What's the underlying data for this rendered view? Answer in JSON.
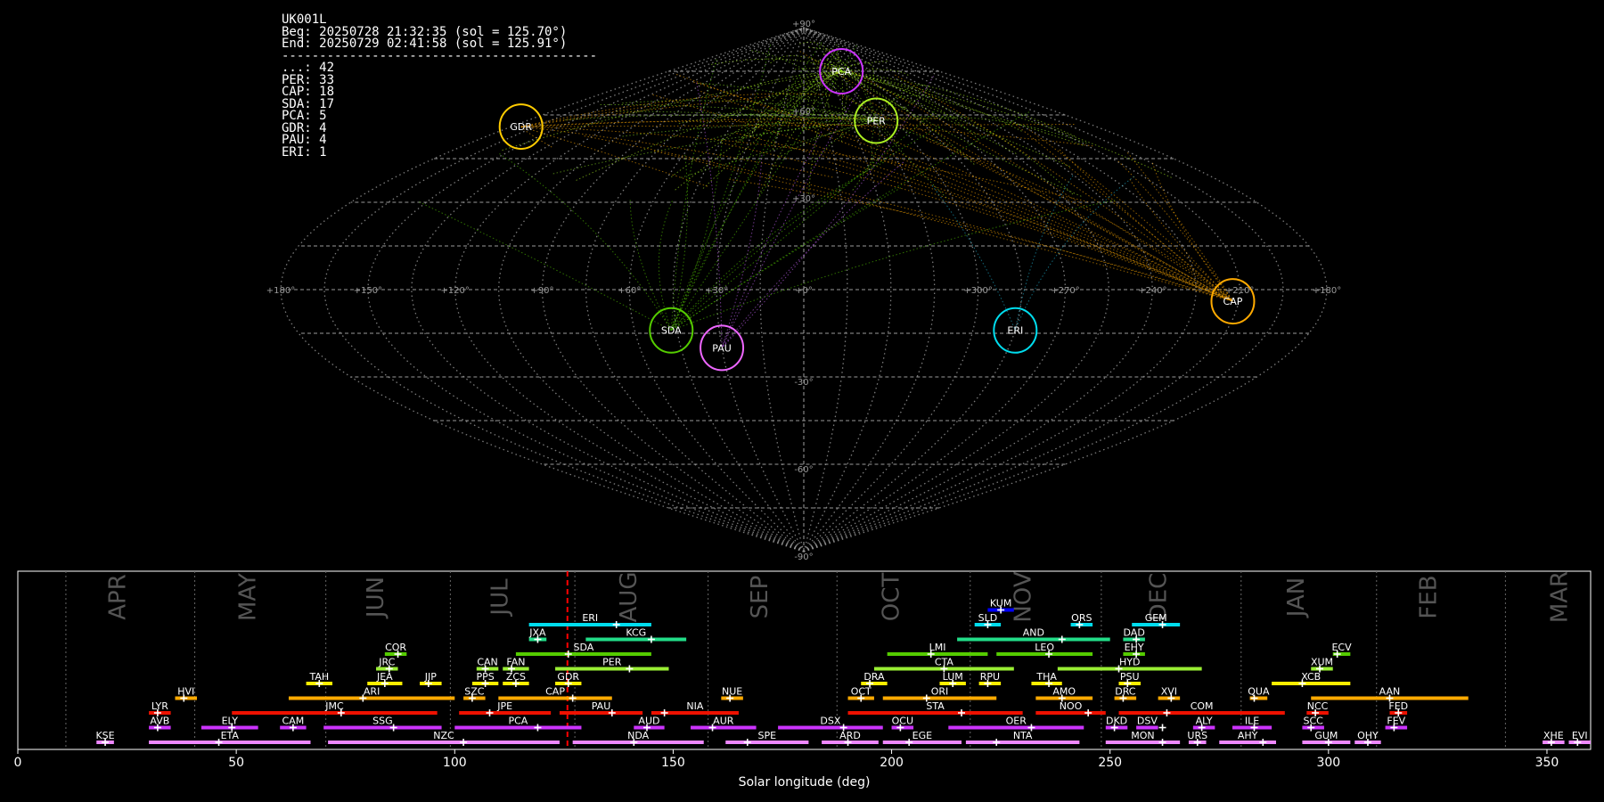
{
  "header": {
    "station": "UK001L",
    "begin": "Beg: 20250728 21:32:35 (sol = 125.70°)",
    "end": "End: 20250729 02:41:58 (sol = 125.91°)",
    "separator": "------------------------------------------",
    "counts": [
      {
        "code": "...",
        "count": 42
      },
      {
        "code": "PER",
        "count": 33
      },
      {
        "code": "CAP",
        "count": 18
      },
      {
        "code": "SDA",
        "count": 17
      },
      {
        "code": "PCA",
        "count": 5
      },
      {
        "code": "GDR",
        "count": 4
      },
      {
        "code": "PAU",
        "count": 4
      },
      {
        "code": "ERI",
        "count": 1
      }
    ]
  },
  "colors": {
    "background": "#000000",
    "grid": "#9a9a9a",
    "sporadic": "#aaee22",
    "current_marker": "#ff0000",
    "month_text": "#555555"
  },
  "chart_data": [
    {
      "type": "scatter",
      "projection": "sinusoidal",
      "title": "",
      "lon_ticks": [
        "+180°",
        "+150°",
        "+120°",
        "+90°",
        "+60°",
        "+30°",
        "+0°",
        "+300°",
        "+270°",
        "+240°",
        "+210°",
        "+180°"
      ],
      "lat_ticks": [
        "+90°",
        "+60°",
        "+30°",
        "-30°",
        "-60°",
        "-90°"
      ],
      "radiants": [
        {
          "name": "PCA",
          "lon": -50,
          "lat": 75,
          "color": "#cc33ff"
        },
        {
          "name": "PER",
          "lon": -47,
          "lat": 58,
          "color": "#aaee22"
        },
        {
          "name": "GDR",
          "lon": 174,
          "lat": 56,
          "color": "#ffcc00"
        },
        {
          "name": "CAP",
          "lon": 212,
          "lat": -4,
          "color": "#ffaa00"
        },
        {
          "name": "SDA",
          "lon": 47,
          "lat": -14,
          "color": "#55cc00"
        },
        {
          "name": "PAU",
          "lon": 30,
          "lat": -20,
          "color": "#ee66ff"
        },
        {
          "name": "ERI",
          "lon": -75,
          "lat": -14,
          "color": "#00ddee"
        }
      ]
    },
    {
      "type": "bar",
      "title": "",
      "xlabel": "Solar longitude (deg)",
      "ylabel": "",
      "xlim": [
        0,
        360
      ],
      "x_ticks": [
        0,
        50,
        100,
        150,
        200,
        250,
        300,
        350
      ],
      "current_sol": 125.8,
      "months": [
        {
          "name": "APR",
          "start": 11
        },
        {
          "name": "MAY",
          "start": 40.5
        },
        {
          "name": "JUN",
          "start": 70.5
        },
        {
          "name": "JUL",
          "start": 99
        },
        {
          "name": "AUG",
          "start": 127.5
        },
        {
          "name": "SEP",
          "start": 158
        },
        {
          "name": "OCT",
          "start": 187.5
        },
        {
          "name": "NOV",
          "start": 218
        },
        {
          "name": "DEC",
          "start": 248
        },
        {
          "name": "JAN",
          "start": 280
        },
        {
          "name": "FEB",
          "start": 311
        },
        {
          "name": "MAR",
          "start": 340.5
        }
      ],
      "showers": [
        {
          "code": "KUM",
          "start": 222,
          "end": 228,
          "peak": 225,
          "row": 9,
          "color": "#0000ff"
        },
        {
          "code": "ERI",
          "start": 117,
          "end": 145,
          "peak": 137,
          "row": 8,
          "color": "#00ddee"
        },
        {
          "code": "SLD",
          "start": 219,
          "end": 225,
          "peak": 222,
          "row": 8,
          "color": "#00ddee"
        },
        {
          "code": "ORS",
          "start": 241,
          "end": 246,
          "peak": 243,
          "row": 8,
          "color": "#00ddee"
        },
        {
          "code": "GEM",
          "start": 255,
          "end": 266,
          "peak": 262,
          "row": 8,
          "color": "#00ddee"
        },
        {
          "code": "JXA",
          "start": 117,
          "end": 121,
          "peak": 119,
          "row": 7,
          "color": "#22dd88"
        },
        {
          "code": "KCG",
          "start": 130,
          "end": 153,
          "peak": 145,
          "row": 7,
          "color": "#22dd88"
        },
        {
          "code": "AND",
          "start": 215,
          "end": 250,
          "peak": 239,
          "row": 7,
          "color": "#22dd88"
        },
        {
          "code": "DAD",
          "start": 253,
          "end": 258,
          "peak": 256,
          "row": 7,
          "color": "#22dd88"
        },
        {
          "code": "COR",
          "start": 84,
          "end": 89,
          "peak": 87,
          "row": 6,
          "color": "#55cc00"
        },
        {
          "code": "SDA",
          "start": 114,
          "end": 145,
          "peak": 126,
          "row": 6,
          "color": "#55cc00"
        },
        {
          "code": "LMI",
          "start": 199,
          "end": 222,
          "peak": 209,
          "row": 6,
          "color": "#55cc00"
        },
        {
          "code": "LEO",
          "start": 224,
          "end": 246,
          "peak": 236,
          "row": 6,
          "color": "#55cc00"
        },
        {
          "code": "EHY",
          "start": 253,
          "end": 258,
          "peak": 256,
          "row": 6,
          "color": "#55cc00"
        },
        {
          "code": "ECV",
          "start": 301,
          "end": 305,
          "peak": 302,
          "row": 6,
          "color": "#55cc00"
        },
        {
          "code": "JRC",
          "start": 82,
          "end": 87,
          "peak": 85,
          "row": 5,
          "color": "#99ee33"
        },
        {
          "code": "CAN",
          "start": 105,
          "end": 110,
          "peak": 107,
          "row": 5,
          "color": "#99ee33"
        },
        {
          "code": "FAN",
          "start": 111,
          "end": 117,
          "peak": 113,
          "row": 5,
          "color": "#99ee33"
        },
        {
          "code": "PER",
          "start": 123,
          "end": 149,
          "peak": 140,
          "row": 5,
          "color": "#99ee33"
        },
        {
          "code": "CTA",
          "start": 196,
          "end": 228,
          "peak": 212,
          "row": 5,
          "color": "#99ee33"
        },
        {
          "code": "HYD",
          "start": 238,
          "end": 271,
          "peak": 252,
          "row": 5,
          "color": "#99ee33"
        },
        {
          "code": "XUM",
          "start": 296,
          "end": 301,
          "peak": 298,
          "row": 5,
          "color": "#99ee33"
        },
        {
          "code": "TAH",
          "start": 66,
          "end": 72,
          "peak": 69,
          "row": 4,
          "color": "#ffee00"
        },
        {
          "code": "JEA",
          "start": 80,
          "end": 88,
          "peak": 84,
          "row": 4,
          "color": "#ffee00"
        },
        {
          "code": "JIP",
          "start": 92,
          "end": 97,
          "peak": 94,
          "row": 4,
          "color": "#ffee00"
        },
        {
          "code": "PPS",
          "start": 104,
          "end": 110,
          "peak": 107,
          "row": 4,
          "color": "#ffee00"
        },
        {
          "code": "ZCS",
          "start": 111,
          "end": 117,
          "peak": 114,
          "row": 4,
          "color": "#ffee00"
        },
        {
          "code": "GDR",
          "start": 123,
          "end": 129,
          "peak": 126,
          "row": 4,
          "color": "#ffee00"
        },
        {
          "code": "DRA",
          "start": 193,
          "end": 199,
          "peak": 195,
          "row": 4,
          "color": "#ffee00"
        },
        {
          "code": "LUM",
          "start": 211,
          "end": 217,
          "peak": 214,
          "row": 4,
          "color": "#ffee00"
        },
        {
          "code": "RPU",
          "start": 220,
          "end": 225,
          "peak": 222,
          "row": 4,
          "color": "#ffee00"
        },
        {
          "code": "THA",
          "start": 232,
          "end": 239,
          "peak": 236,
          "row": 4,
          "color": "#ffee00"
        },
        {
          "code": "PSU",
          "start": 252,
          "end": 257,
          "peak": 254,
          "row": 4,
          "color": "#ffee00"
        },
        {
          "code": "XCB",
          "start": 287,
          "end": 305,
          "peak": 294,
          "row": 4,
          "color": "#ffee00"
        },
        {
          "code": "HVI",
          "start": 36,
          "end": 41,
          "peak": 38,
          "row": 3,
          "color": "#ffaa00"
        },
        {
          "code": "ARI",
          "start": 62,
          "end": 100,
          "peak": 79,
          "row": 3,
          "color": "#ffaa00"
        },
        {
          "code": "SZC",
          "start": 102,
          "end": 107,
          "peak": 104,
          "row": 3,
          "color": "#ffaa00"
        },
        {
          "code": "CAP",
          "start": 110,
          "end": 136,
          "peak": 127,
          "row": 3,
          "color": "#ffaa00"
        },
        {
          "code": "NUE",
          "start": 161,
          "end": 166,
          "peak": 163,
          "row": 3,
          "color": "#ffaa00"
        },
        {
          "code": "OCT",
          "start": 190,
          "end": 196,
          "peak": 193,
          "row": 3,
          "color": "#ffaa00"
        },
        {
          "code": "ORI",
          "start": 198,
          "end": 224,
          "peak": 208,
          "row": 3,
          "color": "#ffaa00"
        },
        {
          "code": "AMO",
          "start": 233,
          "end": 246,
          "peak": 239,
          "row": 3,
          "color": "#ffaa00"
        },
        {
          "code": "DRC",
          "start": 251,
          "end": 256,
          "peak": 253,
          "row": 3,
          "color": "#ffaa00"
        },
        {
          "code": "XVI",
          "start": 261,
          "end": 266,
          "peak": 264,
          "row": 3,
          "color": "#ffaa00"
        },
        {
          "code": "QUA",
          "start": 282,
          "end": 286,
          "peak": 283,
          "row": 3,
          "color": "#ffaa00"
        },
        {
          "code": "AAN",
          "start": 296,
          "end": 332,
          "peak": 314,
          "row": 3,
          "color": "#ffaa00"
        },
        {
          "code": "LYR",
          "start": 30,
          "end": 35,
          "peak": 32,
          "row": 2,
          "color": "#ee1100"
        },
        {
          "code": "JMC",
          "start": 49,
          "end": 96,
          "peak": 74,
          "row": 2,
          "color": "#ee1100"
        },
        {
          "code": "JPE",
          "start": 101,
          "end": 122,
          "peak": 108,
          "row": 2,
          "color": "#ee1100"
        },
        {
          "code": "PAU",
          "start": 124,
          "end": 143,
          "peak": 136,
          "row": 2,
          "color": "#ee1100"
        },
        {
          "code": "NIA",
          "start": 145,
          "end": 165,
          "peak": 148,
          "row": 2,
          "color": "#ee1100"
        },
        {
          "code": "STA",
          "start": 190,
          "end": 230,
          "peak": 216,
          "row": 2,
          "color": "#ee1100"
        },
        {
          "code": "NOO",
          "start": 233,
          "end": 249,
          "peak": 245,
          "row": 2,
          "color": "#ee1100"
        },
        {
          "code": "COM",
          "start": 252,
          "end": 290,
          "peak": 263,
          "row": 2,
          "color": "#ee1100"
        },
        {
          "code": "NCC",
          "start": 295,
          "end": 300,
          "peak": 297,
          "row": 2,
          "color": "#ee1100"
        },
        {
          "code": "FED",
          "start": 314,
          "end": 318,
          "peak": 316,
          "row": 2,
          "color": "#ee1100"
        },
        {
          "code": "AVB",
          "start": 30,
          "end": 35,
          "peak": 32,
          "row": 1,
          "color": "#cc33ff"
        },
        {
          "code": "ELY",
          "start": 42,
          "end": 55,
          "peak": 49,
          "row": 1,
          "color": "#cc33ff"
        },
        {
          "code": "CAM",
          "start": 60,
          "end": 66,
          "peak": 63,
          "row": 1,
          "color": "#cc33ff"
        },
        {
          "code": "SSG",
          "start": 70,
          "end": 97,
          "peak": 86,
          "row": 1,
          "color": "#cc33ff"
        },
        {
          "code": "PCA",
          "start": 100,
          "end": 129,
          "peak": 119,
          "row": 1,
          "color": "#cc33ff"
        },
        {
          "code": "AUD",
          "start": 141,
          "end": 148,
          "peak": 144,
          "row": 1,
          "color": "#cc33ff"
        },
        {
          "code": "AUR",
          "start": 154,
          "end": 169,
          "peak": 159,
          "row": 1,
          "color": "#cc33ff"
        },
        {
          "code": "DSX",
          "start": 174,
          "end": 198,
          "peak": 189,
          "row": 1,
          "color": "#cc33ff"
        },
        {
          "code": "OCU",
          "start": 200,
          "end": 205,
          "peak": 202,
          "row": 1,
          "color": "#cc33ff"
        },
        {
          "code": "OER",
          "start": 213,
          "end": 244,
          "peak": 232,
          "row": 1,
          "color": "#cc33ff"
        },
        {
          "code": "DKD",
          "start": 249,
          "end": 254,
          "peak": 251,
          "row": 1,
          "color": "#cc33ff"
        },
        {
          "code": "DSV",
          "start": 256,
          "end": 261,
          "peak": 262,
          "row": 1,
          "color": "#cc33ff"
        },
        {
          "code": "ALY",
          "start": 269,
          "end": 274,
          "peak": 271,
          "row": 1,
          "color": "#cc33ff"
        },
        {
          "code": "ILE",
          "start": 278,
          "end": 287,
          "peak": 283,
          "row": 1,
          "color": "#cc33ff"
        },
        {
          "code": "SCC",
          "start": 294,
          "end": 299,
          "peak": 296,
          "row": 1,
          "color": "#cc33ff"
        },
        {
          "code": "FEV",
          "start": 313,
          "end": 318,
          "peak": 315,
          "row": 1,
          "color": "#cc33ff"
        },
        {
          "code": "KSE",
          "start": 18,
          "end": 22,
          "peak": 20,
          "row": 0,
          "color": "#ee88ff"
        },
        {
          "code": "ETA",
          "start": 30,
          "end": 67,
          "peak": 46,
          "row": 0,
          "color": "#ee88ff"
        },
        {
          "code": "NZC",
          "start": 71,
          "end": 124,
          "peak": 102,
          "row": 0,
          "color": "#ee88ff"
        },
        {
          "code": "NDA",
          "start": 127,
          "end": 157,
          "peak": 141,
          "row": 0,
          "color": "#ee88ff"
        },
        {
          "code": "SPE",
          "start": 162,
          "end": 181,
          "peak": 167,
          "row": 0,
          "color": "#ee88ff"
        },
        {
          "code": "ARD",
          "start": 184,
          "end": 197,
          "peak": 190,
          "row": 0,
          "color": "#ee88ff"
        },
        {
          "code": "EGE",
          "start": 198,
          "end": 216,
          "peak": 204,
          "row": 0,
          "color": "#ee88ff"
        },
        {
          "code": "NTA",
          "start": 217,
          "end": 243,
          "peak": 224,
          "row": 0,
          "color": "#ee88ff"
        },
        {
          "code": "MON",
          "start": 249,
          "end": 266,
          "peak": 262,
          "row": 0,
          "color": "#ee88ff"
        },
        {
          "code": "URS",
          "start": 268,
          "end": 272,
          "peak": 270,
          "row": 0,
          "color": "#ee88ff"
        },
        {
          "code": "AHY",
          "start": 275,
          "end": 288,
          "peak": 285,
          "row": 0,
          "color": "#ee88ff"
        },
        {
          "code": "GUM",
          "start": 294,
          "end": 305,
          "peak": 300,
          "row": 0,
          "color": "#ee88ff"
        },
        {
          "code": "OHY",
          "start": 306,
          "end": 312,
          "peak": 309,
          "row": 0,
          "color": "#ee88ff"
        },
        {
          "code": "XHE",
          "start": 349,
          "end": 354,
          "peak": 351,
          "row": 0,
          "color": "#ee88ff"
        },
        {
          "code": "EVI",
          "start": 355,
          "end": 360,
          "peak": 357,
          "row": 0,
          "color": "#ee88ff"
        }
      ]
    }
  ]
}
